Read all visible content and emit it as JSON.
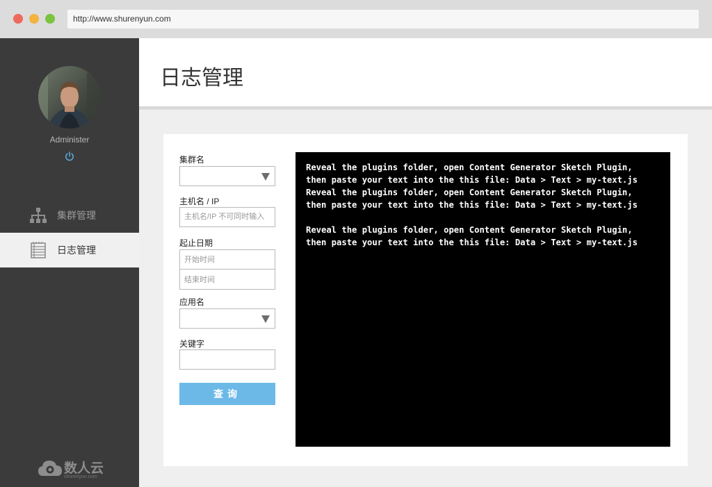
{
  "browser": {
    "url": "http://www.shurenyun.com"
  },
  "sidebar": {
    "username": "Administer",
    "items": [
      {
        "label": "集群管理",
        "icon": "sitemap-icon",
        "active": false
      },
      {
        "label": "日志管理",
        "icon": "list-icon",
        "active": true
      }
    ],
    "brand": {
      "name": "数人云",
      "sub": "shurenyun.com"
    }
  },
  "header": {
    "title": "日志管理"
  },
  "form": {
    "cluster_label": "集群名",
    "cluster_value": "",
    "host_label": "主机名 / IP",
    "host_placeholder": "主机名/IP 不可同时输入",
    "date_label": "起止日期",
    "start_placeholder": "开始时间",
    "end_placeholder": "结束时间",
    "app_label": "应用名",
    "app_value": "",
    "keyword_label": "关键字",
    "keyword_value": "",
    "query_label": "查询"
  },
  "console": {
    "lines": [
      "Reveal the plugins folder, open Content Generator Sketch Plugin,",
      "then paste your text into the this file: Data > Text > my-text.js",
      "Reveal the plugins folder, open Content Generator Sketch Plugin,",
      "then paste your text into the this file: Data > Text > my-text.js",
      "",
      "Reveal the plugins folder, open Content Generator Sketch Plugin,",
      "then paste your text into the this file: Data > Text > my-text.js"
    ]
  },
  "colors": {
    "sidebar": "#3b3b3b",
    "accent": "#6cb9e8",
    "console_bg": "#000000"
  }
}
